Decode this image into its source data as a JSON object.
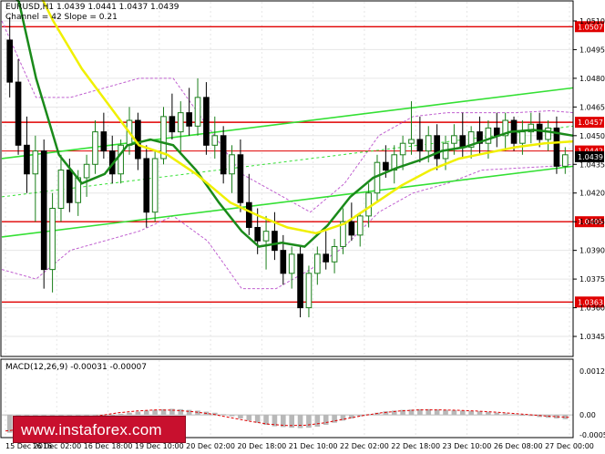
{
  "header": {
    "title": "EURUSD,H1  1.0439 1.0441 1.0437 1.0439",
    "subtitle": "Channel = 42 Slope = 0.21"
  },
  "watermark": "www.instaforex.com",
  "colors": {
    "bull": "#1a7f1a",
    "bear": "#000000",
    "hline": "#e00000",
    "channel": "#34e034",
    "ma_green": "#1a8a1a",
    "ma_yellow": "#f0f000",
    "bollinger": "#c060d0",
    "label_bg": "#e00000"
  },
  "chart_data": [
    {
      "type": "candlestick",
      "symbol": "EURUSD",
      "timeframe": "H1",
      "ylim": [
        1.0335,
        1.052
      ],
      "y_ticks": [
        "1.0510",
        "1.0495",
        "1.0480",
        "1.0465",
        "1.0450",
        "1.0435",
        "1.0420",
        "1.0405",
        "1.0390",
        "1.0375",
        "1.0360",
        "1.0345"
      ],
      "x_ticks": [
        "15 Dec 2016",
        "16 Dec 02:00",
        "16 Dec 18:00",
        "19 Dec 10:00",
        "20 Dec 02:00",
        "20 Dec 18:00",
        "21 Dec 10:00",
        "22 Dec 02:00",
        "22 Dec 18:00",
        "23 Dec 10:00",
        "26 Dec 08:00",
        "27 Dec 00:00"
      ],
      "horizontal_levels": [
        {
          "label": "1.0507",
          "value": 1.0507
        },
        {
          "label": "1.0457",
          "value": 1.0457
        },
        {
          "label": "1.0442",
          "value": 1.0442
        },
        {
          "label": "1.0405",
          "value": 1.0405
        },
        {
          "label": "1.0363",
          "value": 1.0363
        }
      ],
      "current_price": "1.0439",
      "channel": {
        "upper": [
          [
            0,
            1.0438
          ],
          [
            1,
            1.0475
          ]
        ],
        "lower": [
          [
            0,
            1.0397
          ],
          [
            1,
            1.0434
          ]
        ],
        "middle": [
          [
            0,
            1.0418
          ],
          [
            1,
            1.0455
          ]
        ]
      },
      "series": [
        {
          "color": "ma_green",
          "points": [
            [
              0.0,
              1.053
            ],
            [
              0.03,
              1.052
            ],
            [
              0.06,
              1.048
            ],
            [
              0.1,
              1.044
            ],
            [
              0.14,
              1.0425
            ],
            [
              0.18,
              1.043
            ],
            [
              0.22,
              1.0445
            ],
            [
              0.26,
              1.0448
            ],
            [
              0.3,
              1.0445
            ],
            [
              0.34,
              1.0432
            ],
            [
              0.38,
              1.0415
            ],
            [
              0.42,
              1.04
            ],
            [
              0.45,
              1.0392
            ],
            [
              0.49,
              1.0394
            ],
            [
              0.53,
              1.0392
            ],
            [
              0.57,
              1.0403
            ],
            [
              0.61,
              1.0418
            ],
            [
              0.65,
              1.0428
            ],
            [
              0.69,
              1.0433
            ],
            [
              0.73,
              1.0437
            ],
            [
              0.77,
              1.0442
            ],
            [
              0.81,
              1.0444
            ],
            [
              0.85,
              1.0448
            ],
            [
              0.89,
              1.0452
            ],
            [
              0.93,
              1.0453
            ],
            [
              0.96,
              1.0452
            ],
            [
              1.0,
              1.045
            ]
          ]
        },
        {
          "color": "ma_yellow",
          "points": [
            [
              0.0,
              1.056
            ],
            [
              0.04,
              1.054
            ],
            [
              0.09,
              1.051
            ],
            [
              0.14,
              1.0485
            ],
            [
              0.19,
              1.0465
            ],
            [
              0.24,
              1.0445
            ],
            [
              0.29,
              1.044
            ],
            [
              0.34,
              1.043
            ],
            [
              0.4,
              1.0415
            ],
            [
              0.45,
              1.0408
            ],
            [
              0.5,
              1.0402
            ],
            [
              0.55,
              1.0399
            ],
            [
              0.6,
              1.0404
            ],
            [
              0.65,
              1.0414
            ],
            [
              0.7,
              1.0424
            ],
            [
              0.75,
              1.0432
            ],
            [
              0.8,
              1.0438
            ],
            [
              0.85,
              1.0441
            ],
            [
              0.9,
              1.0444
            ],
            [
              0.95,
              1.0446
            ],
            [
              1.0,
              1.0447
            ]
          ]
        },
        {
          "color": "bollinger",
          "dash": true,
          "points": [
            [
              0.0,
              1.051
            ],
            [
              0.06,
              1.047
            ],
            [
              0.12,
              1.047
            ],
            [
              0.18,
              1.0475
            ],
            [
              0.24,
              1.048
            ],
            [
              0.3,
              1.048
            ],
            [
              0.36,
              1.0455
            ],
            [
              0.42,
              1.043
            ],
            [
              0.48,
              1.042
            ],
            [
              0.54,
              1.041
            ],
            [
              0.6,
              1.0425
            ],
            [
              0.66,
              1.045
            ],
            [
              0.72,
              1.046
            ],
            [
              0.78,
              1.0462
            ],
            [
              0.84,
              1.0462
            ],
            [
              0.9,
              1.0462
            ],
            [
              0.96,
              1.0463
            ],
            [
              1.0,
              1.0462
            ]
          ]
        },
        {
          "color": "bollinger",
          "dash": true,
          "points": [
            [
              0.0,
              1.038
            ],
            [
              0.06,
              1.0375
            ],
            [
              0.12,
              1.039
            ],
            [
              0.18,
              1.0395
            ],
            [
              0.24,
              1.04
            ],
            [
              0.3,
              1.0408
            ],
            [
              0.36,
              1.0395
            ],
            [
              0.42,
              1.037
            ],
            [
              0.48,
              1.037
            ],
            [
              0.54,
              1.038
            ],
            [
              0.6,
              1.0392
            ],
            [
              0.66,
              1.041
            ],
            [
              0.72,
              1.042
            ],
            [
              0.78,
              1.0425
            ],
            [
              0.84,
              1.0432
            ],
            [
              0.9,
              1.0433
            ],
            [
              0.96,
              1.0434
            ],
            [
              1.0,
              1.0435
            ]
          ]
        }
      ],
      "candles": [
        [
          1.05,
          1.0512,
          1.047,
          1.0478
        ],
        [
          1.0478,
          1.049,
          1.044,
          1.0445
        ],
        [
          1.0445,
          1.046,
          1.042,
          1.043
        ],
        [
          1.043,
          1.045,
          1.0405,
          1.0442
        ],
        [
          1.0442,
          1.0448,
          1.037,
          1.038
        ],
        [
          1.038,
          1.042,
          1.0368,
          1.0412
        ],
        [
          1.0412,
          1.044,
          1.0405,
          1.0432
        ],
        [
          1.0432,
          1.0438,
          1.041,
          1.0415
        ],
        [
          1.0415,
          1.0432,
          1.0408,
          1.0428
        ],
        [
          1.0428,
          1.044,
          1.0418,
          1.0435
        ],
        [
          1.0435,
          1.0458,
          1.043,
          1.0452
        ],
        [
          1.0452,
          1.0462,
          1.0438,
          1.0442
        ],
        [
          1.0442,
          1.045,
          1.0425,
          1.043
        ],
        [
          1.043,
          1.0448,
          1.0425,
          1.0445
        ],
        [
          1.0445,
          1.0465,
          1.044,
          1.0458
        ],
        [
          1.0458,
          1.0462,
          1.0432,
          1.0438
        ],
        [
          1.0438,
          1.0445,
          1.0402,
          1.041
        ],
        [
          1.041,
          1.0442,
          1.0405,
          1.0438
        ],
        [
          1.0438,
          1.0465,
          1.0435,
          1.046
        ],
        [
          1.046,
          1.0472,
          1.0448,
          1.0452
        ],
        [
          1.0452,
          1.0468,
          1.044,
          1.0462
        ],
        [
          1.0462,
          1.0475,
          1.045,
          1.0455
        ],
        [
          1.0455,
          1.048,
          1.045,
          1.047
        ],
        [
          1.047,
          1.0478,
          1.044,
          1.0445
        ],
        [
          1.0445,
          1.046,
          1.0438,
          1.045
        ],
        [
          1.045,
          1.0455,
          1.0425,
          1.043
        ],
        [
          1.043,
          1.0445,
          1.042,
          1.044
        ],
        [
          1.044,
          1.0448,
          1.041,
          1.0415
        ],
        [
          1.0415,
          1.043,
          1.0398,
          1.0402
        ],
        [
          1.0402,
          1.0412,
          1.0388,
          1.0395
        ],
        [
          1.0395,
          1.0408,
          1.038,
          1.04
        ],
        [
          1.04,
          1.041,
          1.0385,
          1.039
        ],
        [
          1.039,
          1.0398,
          1.0372,
          1.0378
        ],
        [
          1.0378,
          1.0392,
          1.037,
          1.0388
        ],
        [
          1.0388,
          1.0392,
          1.0355,
          1.036
        ],
        [
          1.036,
          1.0382,
          1.0355,
          1.0378
        ],
        [
          1.0378,
          1.0392,
          1.0372,
          1.0388
        ],
        [
          1.0388,
          1.04,
          1.038,
          1.0384
        ],
        [
          1.0384,
          1.0396,
          1.0378,
          1.0392
        ],
        [
          1.0392,
          1.0412,
          1.0388,
          1.0405
        ],
        [
          1.0405,
          1.0415,
          1.0395,
          1.0398
        ],
        [
          1.0398,
          1.041,
          1.0392,
          1.0408
        ],
        [
          1.0408,
          1.0425,
          1.0402,
          1.042
        ],
        [
          1.042,
          1.044,
          1.0415,
          1.0436
        ],
        [
          1.0436,
          1.0445,
          1.0428,
          1.0432
        ],
        [
          1.0432,
          1.0445,
          1.0425,
          1.044
        ],
        [
          1.044,
          1.045,
          1.0432,
          1.0446
        ],
        [
          1.0446,
          1.0468,
          1.044,
          1.0448
        ],
        [
          1.0448,
          1.046,
          1.0436,
          1.0442
        ],
        [
          1.0442,
          1.0455,
          1.0436,
          1.045
        ],
        [
          1.045,
          1.0456,
          1.0432,
          1.0438
        ],
        [
          1.0438,
          1.045,
          1.0432,
          1.0446
        ],
        [
          1.0446,
          1.0456,
          1.044,
          1.045
        ],
        [
          1.045,
          1.0462,
          1.0438,
          1.0444
        ],
        [
          1.0444,
          1.0455,
          1.0438,
          1.0452
        ],
        [
          1.0452,
          1.046,
          1.044,
          1.0446
        ],
        [
          1.0446,
          1.0458,
          1.0438,
          1.0454
        ],
        [
          1.0454,
          1.0462,
          1.0444,
          1.045
        ],
        [
          1.045,
          1.0462,
          1.0442,
          1.0458
        ],
        [
          1.0458,
          1.046,
          1.0442,
          1.0446
        ],
        [
          1.0446,
          1.0458,
          1.044,
          1.0452
        ],
        [
          1.0452,
          1.0462,
          1.0446,
          1.0456
        ],
        [
          1.0456,
          1.0462,
          1.0444,
          1.0448
        ],
        [
          1.0448,
          1.0458,
          1.0442,
          1.0454
        ],
        [
          1.0454,
          1.046,
          1.043,
          1.0434
        ],
        [
          1.0434,
          1.0444,
          1.043,
          1.044
        ]
      ]
    },
    {
      "type": "bar",
      "title": "MACD(12,26,9) -0.00031 -0.00007",
      "ylim": [
        -0.00056,
        0.00123
      ],
      "y_ticks": [
        "0.00123",
        "0.00",
        "-0.00056"
      ],
      "values": [
        -0.0005,
        -0.00052,
        -0.00048,
        -0.00044,
        -0.0004,
        -0.00036,
        -0.0003,
        -0.00024,
        -0.00018,
        -0.00012,
        -8e-05,
        -4e-05,
        0.0,
        3e-05,
        6e-05,
        9e-05,
        0.00012,
        0.00014,
        0.00016,
        0.00017,
        0.00016,
        0.00014,
        0.00012,
        9e-05,
        6e-05,
        2e-05,
        -4e-05,
        -0.0001,
        -0.00016,
        -0.00022,
        -0.00028,
        -0.00032,
        -0.00034,
        -0.00036,
        -0.00037,
        -0.00036,
        -0.00033,
        -0.00028,
        -0.00022,
        -0.00016,
        -0.0001,
        -4e-05,
        2e-05,
        6e-05,
        0.0001,
        0.00012,
        0.00014,
        0.00015,
        0.00016,
        0.00016,
        0.00015,
        0.00014,
        0.00013,
        0.00012,
        0.00011,
        0.0001,
        8e-05,
        6e-05,
        4e-05,
        2e-05,
        0.0,
        -3e-05,
        -6e-05,
        -8e-05,
        -0.0001,
        -0.00012
      ],
      "signal": [
        -0.00045,
        -0.0004,
        -0.0003,
        -0.0002,
        -0.0001,
        -2e-05,
        6e-05,
        0.00011,
        0.00014,
        0.00013,
        9e-05,
        2e-05,
        -8e-05,
        -0.00018,
        -0.00026,
        -0.0003,
        -0.00029,
        -0.00022,
        -0.00012,
        -2e-05,
        6e-05,
        0.00011,
        0.00014,
        0.00014,
        0.00013,
        0.00011,
        8e-05,
        4e-05,
        0.0,
        -4e-05,
        -7e-05
      ]
    }
  ]
}
